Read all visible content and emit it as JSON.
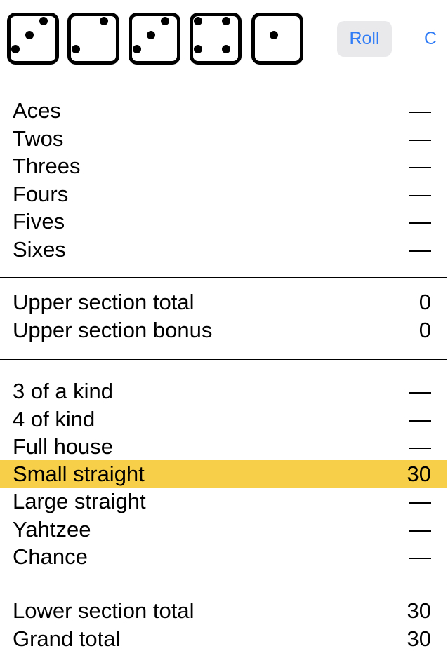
{
  "toolbar": {
    "dice": [
      {
        "face": 3
      },
      {
        "face": 2
      },
      {
        "face": 3
      },
      {
        "face": 4
      },
      {
        "face": 1
      }
    ],
    "roll_label": "Roll",
    "c_label": "C"
  },
  "upper": [
    {
      "label": "Aces",
      "value": "—"
    },
    {
      "label": "Twos",
      "value": "—"
    },
    {
      "label": "Threes",
      "value": "—"
    },
    {
      "label": "Fours",
      "value": "—"
    },
    {
      "label": "Fives",
      "value": "—"
    },
    {
      "label": "Sixes",
      "value": "—"
    }
  ],
  "upper_totals": [
    {
      "label": "Upper section total",
      "value": "0"
    },
    {
      "label": "Upper section bonus",
      "value": "0"
    }
  ],
  "lower": [
    {
      "label": "3 of a kind",
      "value": "—"
    },
    {
      "label": "4 of kind",
      "value": "—"
    },
    {
      "label": "Full house",
      "value": "—"
    },
    {
      "label": "Small straight",
      "value": "30",
      "highlighted": true
    },
    {
      "label": "Large straight",
      "value": "—"
    },
    {
      "label": "Yahtzee",
      "value": "—"
    },
    {
      "label": "Chance",
      "value": "—"
    }
  ],
  "lower_totals": [
    {
      "label": "Lower section total",
      "value": "30"
    },
    {
      "label": "Grand total",
      "value": "30"
    }
  ],
  "colors": {
    "accent": "#2f7cf6",
    "highlight": "#f7cf48",
    "button_bg": "#e9e9ec"
  }
}
